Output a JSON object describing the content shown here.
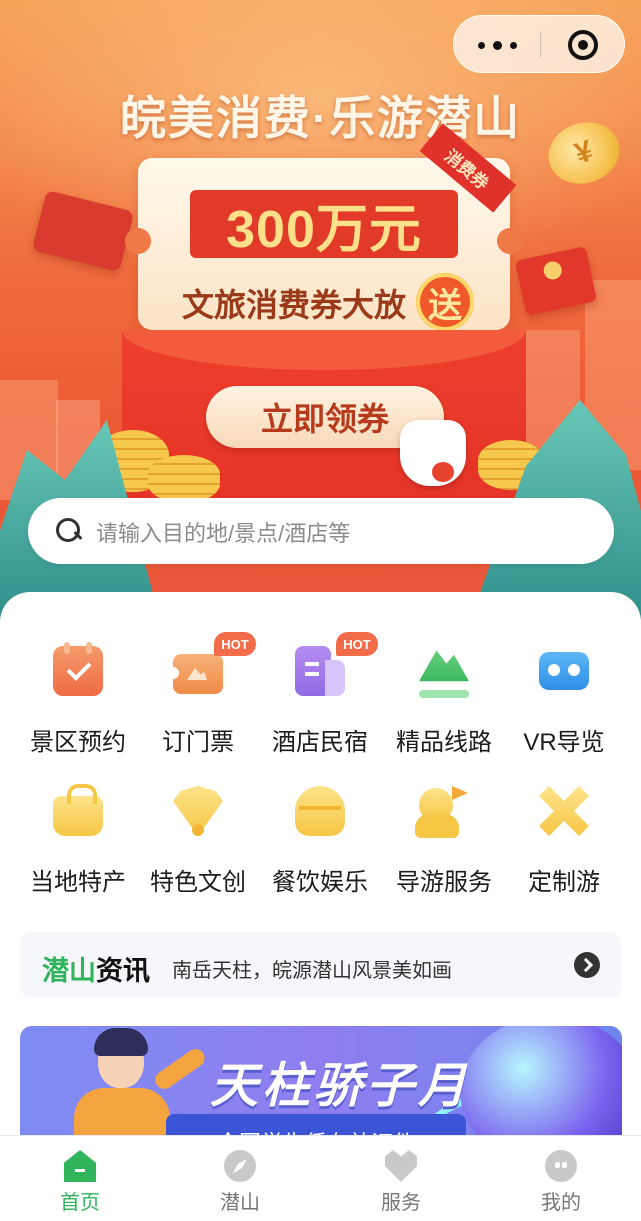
{
  "app": {
    "menu_icon": "more-dots-icon",
    "close_icon": "close-target-icon"
  },
  "banner": {
    "title": "皖美消费·乐游潜山",
    "coupon_tag": "消费券",
    "amount": "300万元",
    "subtitle": "文旅消费券大放",
    "badge": "送",
    "cta": "立即领券"
  },
  "search": {
    "placeholder": "请输入目的地/景点/酒店等",
    "icon": "search-icon"
  },
  "services": [
    {
      "label": "景区预约",
      "icon": "calendar-check-icon",
      "hot": ""
    },
    {
      "label": "订门票",
      "icon": "ticket-icon",
      "hot": "HOT"
    },
    {
      "label": "酒店民宿",
      "icon": "hotel-icon",
      "hot": "HOT"
    },
    {
      "label": "精品线路",
      "icon": "mountain-icon",
      "hot": ""
    },
    {
      "label": "VR导览",
      "icon": "vr-glasses-icon",
      "hot": ""
    },
    {
      "label": "当地特产",
      "icon": "shopping-bag-icon",
      "hot": ""
    },
    {
      "label": "特色文创",
      "icon": "fan-icon",
      "hot": ""
    },
    {
      "label": "餐饮娱乐",
      "icon": "bowl-icon",
      "hot": ""
    },
    {
      "label": "导游服务",
      "icon": "tour-guide-icon",
      "hot": ""
    },
    {
      "label": "定制游",
      "icon": "custom-tour-icon",
      "hot": ""
    }
  ],
  "news": {
    "brand_green": "潜山",
    "brand_black": "资讯",
    "text": "南岳天柱，皖源潜山风景美如画"
  },
  "promo": {
    "title": "天柱骄子月",
    "subtitle": "全国学生凭有效证件"
  },
  "tabbar": [
    {
      "label": "首页",
      "icon": "home-icon",
      "active": true
    },
    {
      "label": "潜山",
      "icon": "compass-icon",
      "active": false
    },
    {
      "label": "服务",
      "icon": "service-icon",
      "active": false
    },
    {
      "label": "我的",
      "icon": "profile-icon",
      "active": false
    }
  ],
  "colors": {
    "accent_green": "#2fb45b",
    "hero_orange": "#ef6a3c",
    "hot_badge": "#f26c4a"
  }
}
